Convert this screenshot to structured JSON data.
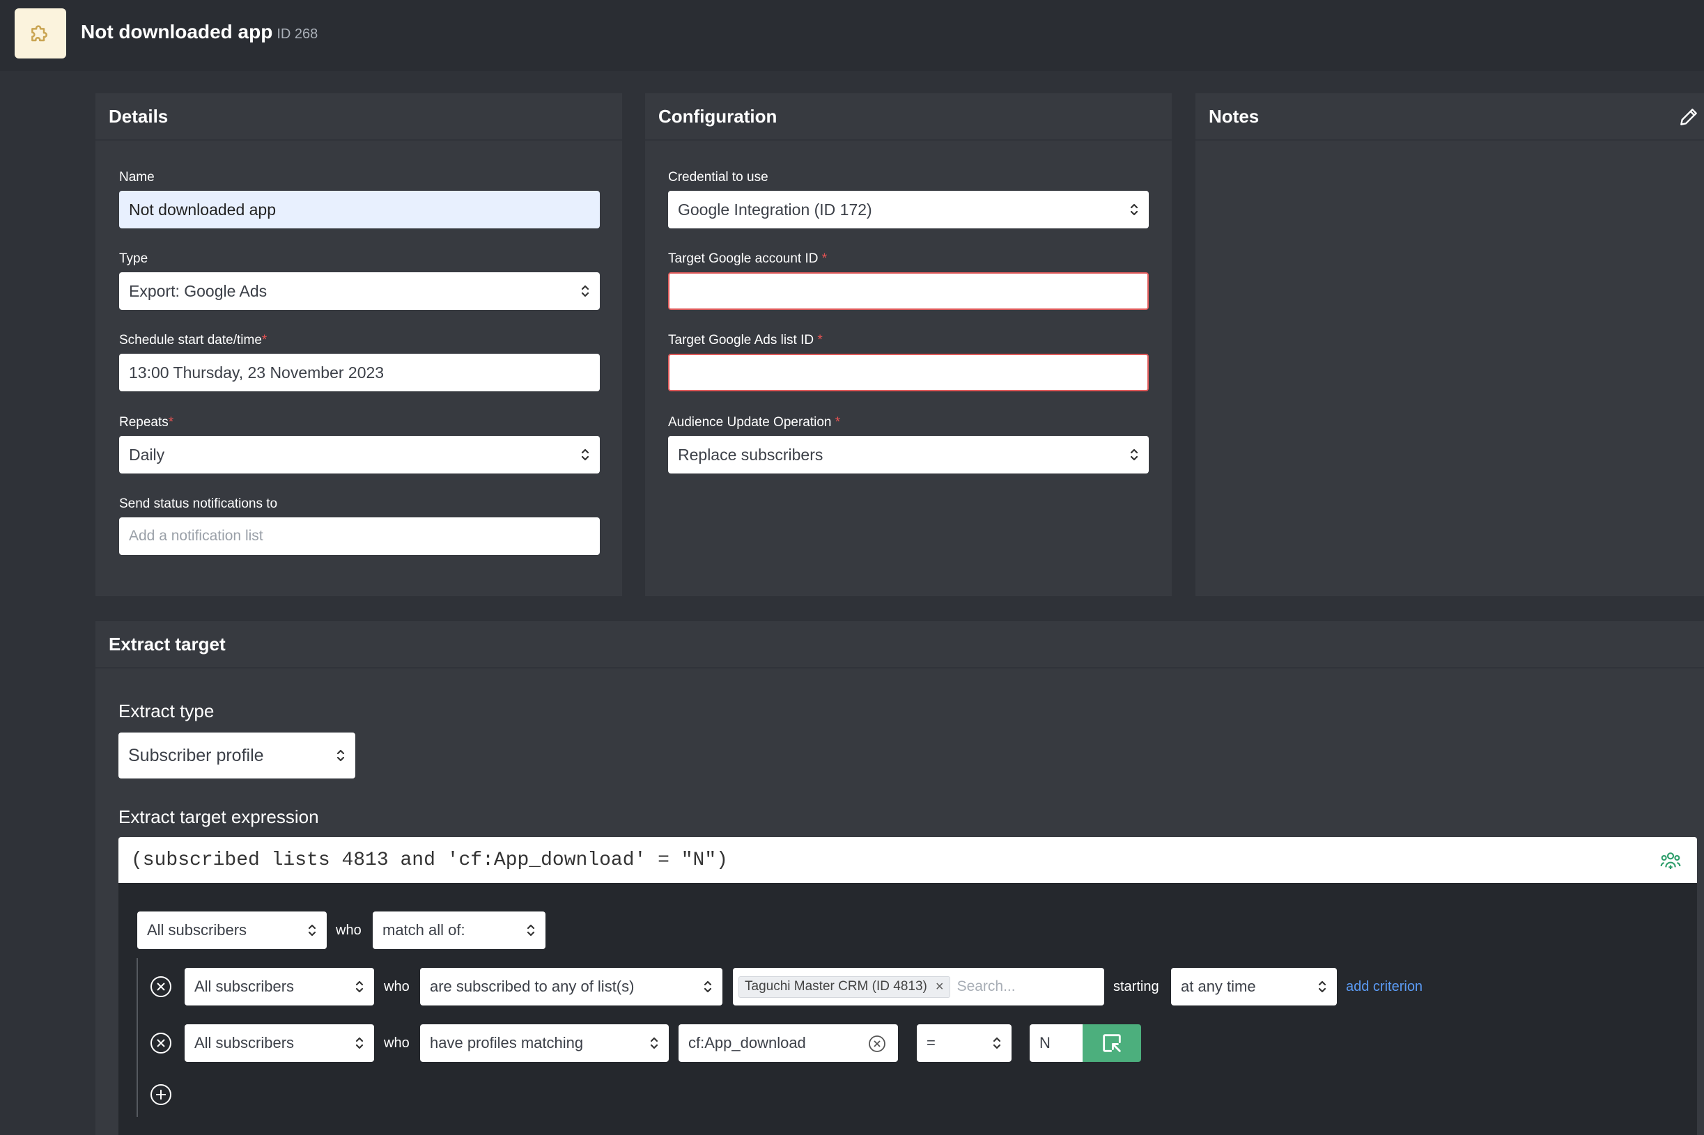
{
  "header": {
    "title": "Not downloaded app",
    "id_label": "ID 268"
  },
  "details": {
    "title": "Details",
    "name_label": "Name",
    "name_value": "Not downloaded app",
    "type_label": "Type",
    "type_value": "Export: Google Ads",
    "schedule_label": "Schedule start date/time",
    "schedule_value": "13:00 Thursday, 23 November 2023",
    "repeats_label": "Repeats",
    "repeats_value": "Daily",
    "notify_label": "Send status notifications to",
    "notify_placeholder": "Add a notification list",
    "required_mark": "*"
  },
  "configuration": {
    "title": "Configuration",
    "credential_label": "Credential to use",
    "credential_value": "Google Integration (ID 172)",
    "account_label": "Target Google account ID",
    "account_value": "",
    "list_label": "Target Google Ads list ID",
    "list_value": "",
    "operation_label": "Audience Update Operation",
    "operation_value": "Replace subscribers",
    "required_mark": "*"
  },
  "notes": {
    "title": "Notes"
  },
  "extract": {
    "title": "Extract target",
    "type_label": "Extract type",
    "type_value": "Subscriber profile",
    "expression_label": "Extract target expression",
    "expression_value": "(subscribed lists 4813 and 'cf:App_download' = \"N\")"
  },
  "builder": {
    "root_scope": "All subscribers",
    "who": "who",
    "root_match": "match all of:",
    "rows": [
      {
        "scope": "All subscribers",
        "condition": "are subscribed to any of list(s)",
        "tag": "Taguchi Master CRM (ID 4813)",
        "tag_remove": "×",
        "search_placeholder": "Search...",
        "starting_label": "starting",
        "time_value": "at any time",
        "add_criterion": "add criterion"
      },
      {
        "scope": "All subscribers",
        "condition": "have profiles matching",
        "field": "cf:App_download",
        "operator": "=",
        "value": "N"
      }
    ]
  },
  "colors": {
    "background": "#2f3238",
    "panel": "#373a40",
    "builder_bg": "#25282d",
    "accent_green": "#4caf7d",
    "link_blue": "#5b9bf5",
    "error_red": "#e05b5b"
  }
}
